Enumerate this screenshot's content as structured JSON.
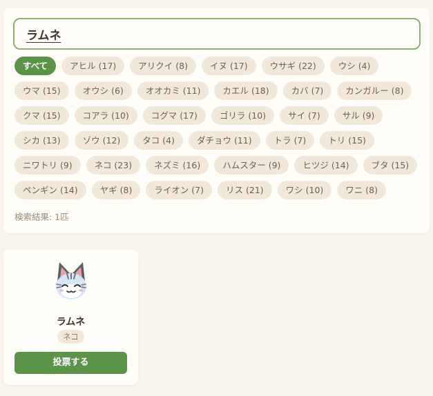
{
  "search": {
    "value": "ラムネ"
  },
  "filters": [
    {
      "label": "すべて",
      "active": true
    },
    {
      "label": "アヒル (17)"
    },
    {
      "label": "アリクイ (8)"
    },
    {
      "label": "イヌ (17)"
    },
    {
      "label": "ウサギ (22)"
    },
    {
      "label": "ウシ (4)"
    },
    {
      "label": "ウマ (15)"
    },
    {
      "label": "オウシ (6)"
    },
    {
      "label": "オオカミ (11)"
    },
    {
      "label": "カエル (18)"
    },
    {
      "label": "カバ (7)"
    },
    {
      "label": "カンガルー (8)"
    },
    {
      "label": "クマ (15)"
    },
    {
      "label": "コアラ (10)"
    },
    {
      "label": "コグマ (17)"
    },
    {
      "label": "ゴリラ (10)"
    },
    {
      "label": "サイ (7)"
    },
    {
      "label": "サル (9)"
    },
    {
      "label": "シカ (13)"
    },
    {
      "label": "ゾウ (12)"
    },
    {
      "label": "タコ (4)"
    },
    {
      "label": "ダチョウ (11)"
    },
    {
      "label": "トラ (7)"
    },
    {
      "label": "トリ (15)"
    },
    {
      "label": "ニワトリ (9)"
    },
    {
      "label": "ネコ (23)"
    },
    {
      "label": "ネズミ (16)"
    },
    {
      "label": "ハムスター (9)"
    },
    {
      "label": "ヒツジ (14)"
    },
    {
      "label": "ブタ (15)"
    },
    {
      "label": "ペンギン (14)"
    },
    {
      "label": "ヤギ (8)"
    },
    {
      "label": "ライオン (7)"
    },
    {
      "label": "リス (21)"
    },
    {
      "label": "ワシ (10)"
    },
    {
      "label": "ワニ (8)"
    }
  ],
  "result_count": "検索結果: 1匹",
  "results": [
    {
      "name": "ラムネ",
      "species": "ネコ",
      "vote_label": "投票する",
      "icon": "cat-villager-icon"
    }
  ],
  "colors": {
    "accent": "#5b9349",
    "search_border": "#88b070",
    "chip_bg": "#f1e8da",
    "page_bg": "#f8f4ec",
    "card_bg": "#fffdf7"
  }
}
